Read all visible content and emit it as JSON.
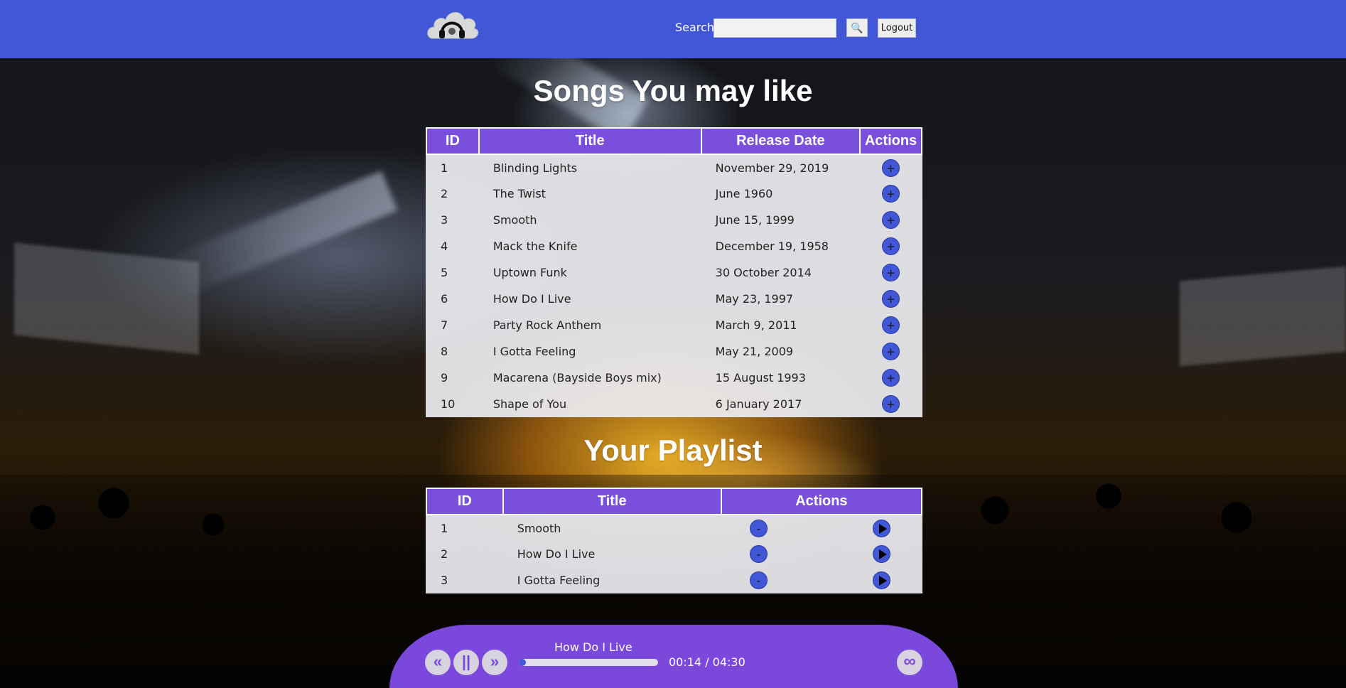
{
  "header": {
    "logo_alt": "headphones cloud logo",
    "search_label": "Search",
    "search_value": "",
    "search_button_icon": "search-icon",
    "logout_label": "Logout",
    "bg_color": "#4157d6"
  },
  "recommendations": {
    "title": "Songs You may like",
    "columns": [
      "ID",
      "Title",
      "Release Date",
      "Actions"
    ],
    "add_label": "+",
    "rows": [
      {
        "id": "1",
        "title": "Blinding Lights",
        "date": "November 29, 2019"
      },
      {
        "id": "2",
        "title": "The Twist",
        "date": "June 1960"
      },
      {
        "id": "3",
        "title": "Smooth",
        "date": "June 15, 1999"
      },
      {
        "id": "4",
        "title": "Mack the Knife",
        "date": "December 19, 1958"
      },
      {
        "id": "5",
        "title": "Uptown Funk",
        "date": "30 October 2014"
      },
      {
        "id": "6",
        "title": "How Do I Live",
        "date": "May 23, 1997"
      },
      {
        "id": "7",
        "title": "Party Rock Anthem",
        "date": "March 9, 2011"
      },
      {
        "id": "8",
        "title": "I Gotta Feeling",
        "date": "May 21, 2009"
      },
      {
        "id": "9",
        "title": "Macarena (Bayside Boys mix)",
        "date": "15 August 1993"
      },
      {
        "id": "10",
        "title": "Shape of You",
        "date": "6 January 2017"
      }
    ]
  },
  "playlist": {
    "title": "Your Playlist",
    "columns": [
      "ID",
      "Title",
      "Actions"
    ],
    "remove_label": "-",
    "rows": [
      {
        "id": "1",
        "title": "Smooth"
      },
      {
        "id": "2",
        "title": "How Do I Live"
      },
      {
        "id": "3",
        "title": "I Gotta Feeling"
      }
    ]
  },
  "player": {
    "track_title": "How Do I Live",
    "time_display": "00:14 / 04:30",
    "progress_fraction": 0.05,
    "prev_label": "«",
    "pause_label": "||",
    "next_label": "»",
    "loop_label": "∞",
    "bg_color": "#7a48da"
  }
}
